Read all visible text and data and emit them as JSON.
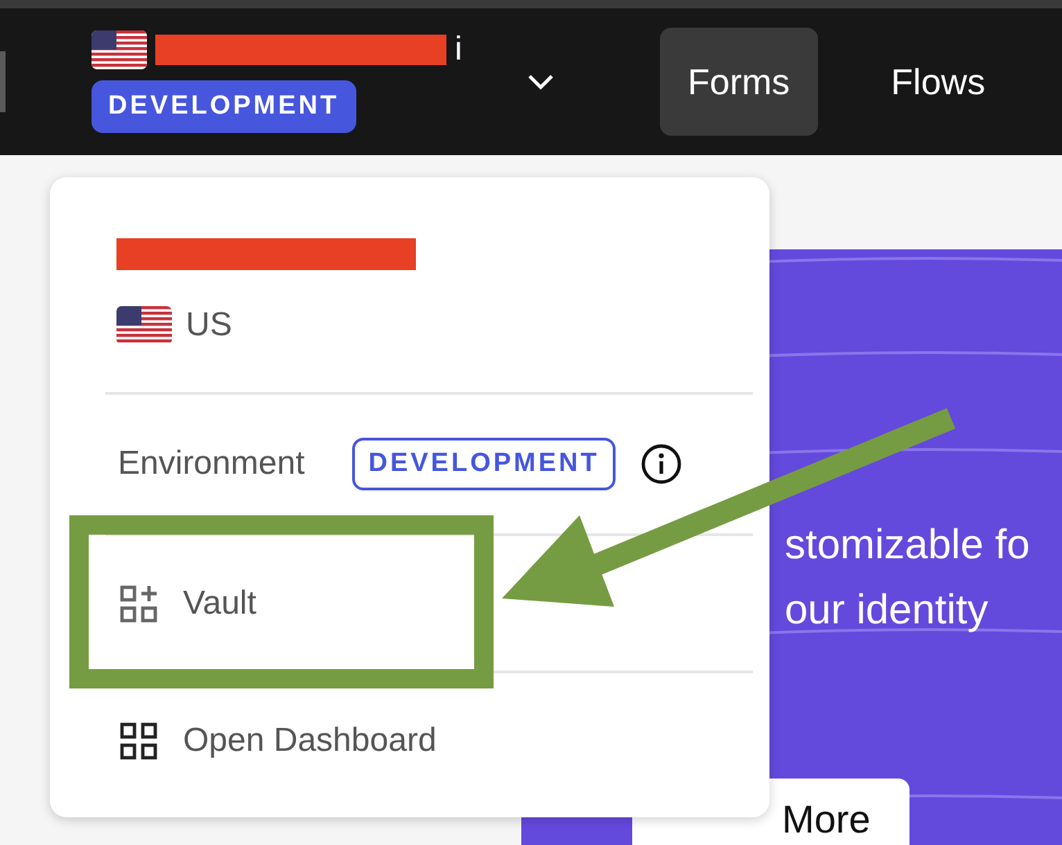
{
  "top_bar": {
    "name_redacted": true,
    "name_fragment": "i",
    "environment_badge": "DEVELOPMENT",
    "nav": [
      {
        "label": "Forms",
        "selected": true
      },
      {
        "label": "Flows",
        "selected": false
      }
    ]
  },
  "hero": {
    "lines": [
      "stomizable fo",
      "our identity"
    ],
    "button": "More"
  },
  "account_menu": {
    "name_redacted": true,
    "region": "US",
    "environment": {
      "label": "Environment",
      "badge": "DEVELOPMENT"
    },
    "items": [
      {
        "kind": "vault",
        "label": "Vault",
        "highlighted": true
      },
      {
        "kind": "dashboard",
        "label": "Open Dashboard",
        "highlighted": false
      }
    ]
  }
}
